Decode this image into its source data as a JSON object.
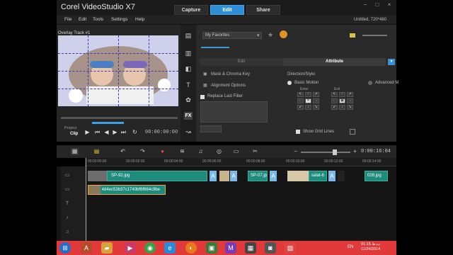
{
  "app": {
    "title": "Corel  VideoStudio X7",
    "project": "Untitled, 720*480"
  },
  "workspace_tabs": [
    "Capture",
    "Edit",
    "Share"
  ],
  "menu": [
    "File",
    "Edit",
    "Tools",
    "Settings",
    "Help"
  ],
  "preview": {
    "overlay_label": "Overlay Track #1",
    "mode_project": "Project",
    "mode_clip": "Clip",
    "timecode": "00:00:00:00"
  },
  "library": {
    "favorites": "My Favorites"
  },
  "options": {
    "tab_edit": "Edit",
    "tab_attribute": "Attribute",
    "mask_chroma": "Mask & Chroma Key",
    "alignment": "Alignment Options",
    "replace_last_filter": "Replace Last Filter",
    "direction_style": "Direction/Style:",
    "basic_motion": "Basic Motion",
    "advanced": "Advanced M",
    "show_grid_lines": "Show Grid Lines",
    "enter": "Enter",
    "exit": "Exit"
  },
  "timeline": {
    "timecode": "0:00:16:04",
    "ruler_ticks": [
      "00:00:00:00",
      "00:00:02:00",
      "00:00:04:00",
      "00:00:06:00",
      "00:00:08:00",
      "00:00:10:00",
      "00:00:12:00",
      "00:00:14:00"
    ],
    "video_clips": [
      {
        "label": "SP-92.jpg"
      },
      {
        "label": "SP-07.jp"
      },
      {
        "label": "salat-6"
      },
      {
        "label": "028.jpg"
      }
    ],
    "overlay_clip": "4d4ec53b37c1740bf6f664c9be"
  },
  "taskbar": {
    "lang": "EN",
    "time": "01:15 ب.ظ",
    "date": "11/24/2014"
  },
  "colors": {
    "accent": "#2d8fd8",
    "clip": "#1e8b7d",
    "taskbar": "#e23a3a"
  }
}
